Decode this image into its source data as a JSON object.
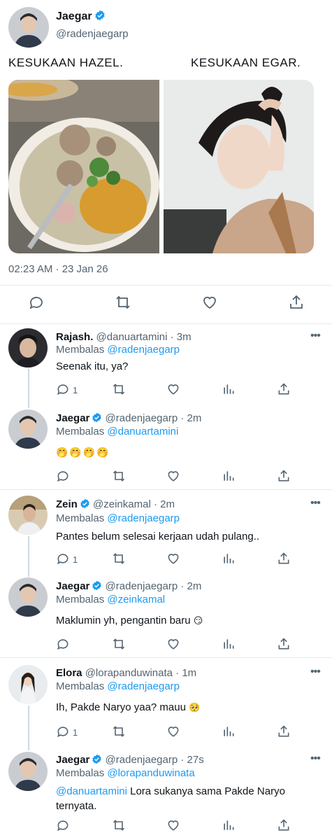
{
  "main": {
    "name": "Jaegar",
    "handle": "@radenjaegarp",
    "caption_left": "KESUKAAN HAZEL.",
    "caption_right": "KESUKAAN EGAR.",
    "timestamp": "02:23 AM · 23 Jan 26"
  },
  "replies": [
    {
      "name": "Rajash.",
      "meta": "@danuartamini · 3m",
      "replying_label": "Membalas",
      "replying_to": "@radenjaegarp",
      "text": "Seenak itu, ya?",
      "reply_count": "1",
      "verified": false
    },
    {
      "name": "Jaegar",
      "meta": "@radenjaegarp · 2m",
      "replying_label": "Membalas",
      "replying_to": "@danuartamini",
      "text": "",
      "emoji": "🤭🤭🤭🤭",
      "reply_count": "",
      "verified": true
    },
    {
      "name": "Zein",
      "meta": "@zeinkamal · 2m",
      "replying_label": "Membalas",
      "replying_to": "@radenjaegarp",
      "text": "Pantes belum selesai kerjaan udah pulang..",
      "reply_count": "1",
      "verified": true
    },
    {
      "name": "Jaegar",
      "meta": "@radenjaegarp · 2m",
      "replying_label": "Membalas",
      "replying_to": "@zeinkamal",
      "text": "Maklumin yh, pengantin baru",
      "emoji": "😏",
      "reply_count": "",
      "verified": true
    },
    {
      "name": "Elora",
      "meta": "@lorapanduwinata · 1m",
      "replying_label": "Membalas",
      "replying_to": "@radenjaegarp",
      "text": "Ih, Pakde Naryo yaa? mauu",
      "emoji": "🥺",
      "reply_count": "1",
      "verified": false
    },
    {
      "name": "Jaegar",
      "meta": "@radenjaegarp · 27s",
      "replying_label": "Membalas",
      "replying_to": "@lorapanduwinata",
      "text_mention": "@danuartamini",
      "text": "Lora sukanya sama Pakde Naryo ternyata.",
      "reply_count": "",
      "verified": true
    }
  ],
  "more_label": "•••",
  "icons": [
    "reply-icon",
    "retweet-icon",
    "like-icon",
    "views-icon",
    "share-icon",
    "verified-icon",
    "more-icon"
  ],
  "colors": {
    "accent": "#1d9bf0",
    "secondary": "#536471",
    "divider": "#e6ecf0"
  }
}
